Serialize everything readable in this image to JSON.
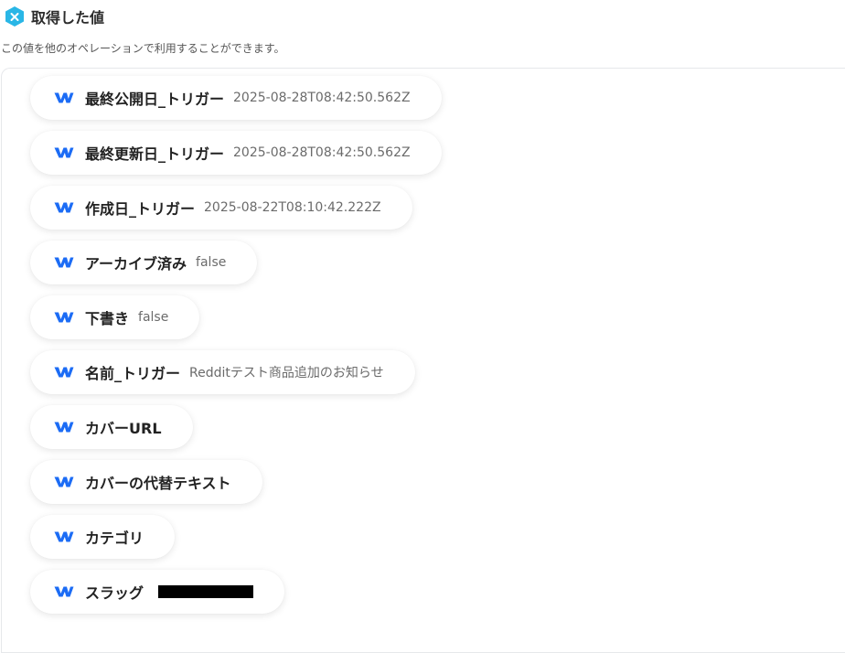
{
  "header": {
    "title": "取得した値",
    "subtitle": "この値を他のオペレーションで利用することができます。"
  },
  "colors": {
    "brand_icon": "#1c6cf5",
    "header_icon_bg": "#29b6e6"
  },
  "items": [
    {
      "label": "最終公開日_トリガー",
      "value": "2025-08-28T08:42:50.562Z"
    },
    {
      "label": "最終更新日_トリガー",
      "value": "2025-08-28T08:42:50.562Z"
    },
    {
      "label": "作成日_トリガー",
      "value": "2025-08-22T08:10:42.222Z"
    },
    {
      "label": "アーカイブ済み",
      "value": "false"
    },
    {
      "label": "下書き",
      "value": "false"
    },
    {
      "label": "名前_トリガー",
      "value": "Redditテスト商品追加のお知らせ"
    },
    {
      "label": "カバーURL",
      "value": ""
    },
    {
      "label": "カバーの代替テキスト",
      "value": ""
    },
    {
      "label": "カテゴリ",
      "value": ""
    },
    {
      "label": "スラッグ",
      "value": ""
    }
  ]
}
